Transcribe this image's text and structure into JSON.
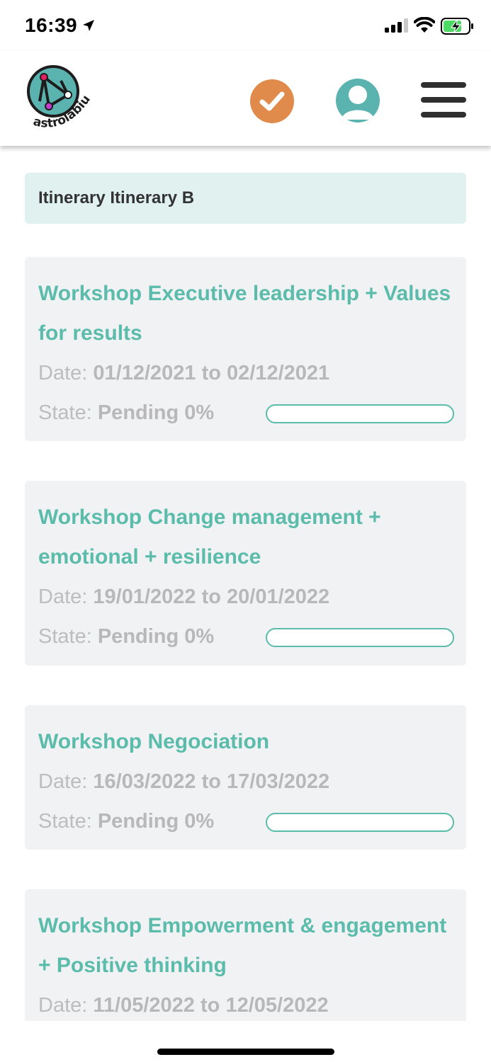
{
  "status_bar": {
    "time": "16:39"
  },
  "header": {
    "logo_text": "astrolabium",
    "icons": [
      "location-arrow-icon",
      "signal-icon",
      "wifi-icon",
      "battery-charging-icon",
      "checkmark-icon",
      "user-icon",
      "hamburger-menu-icon"
    ],
    "colors": {
      "accent": "#5bbcab",
      "check_button": "#e08b4c",
      "user_button": "#5bb3b0"
    }
  },
  "itinerary": {
    "title": "Itinerary Itinerary B"
  },
  "labels": {
    "date": "Date:",
    "to": "to",
    "state": "State:"
  },
  "workshops": [
    {
      "title": "Workshop Executive leadership + Values for results",
      "date_from": "01/12/2021",
      "date_to": "02/12/2021",
      "state": "Pending",
      "progress_text": "0%",
      "progress": 0
    },
    {
      "title": "Workshop Change management + emotional + resilience",
      "date_from": "19/01/2022",
      "date_to": "20/01/2022",
      "state": "Pending",
      "progress_text": "0%",
      "progress": 0
    },
    {
      "title": "Workshop Negociation",
      "date_from": "16/03/2022",
      "date_to": "17/03/2022",
      "state": "Pending",
      "progress_text": "0%",
      "progress": 0
    },
    {
      "title": "Workshop Empowerment & engagement + Positive thinking",
      "date_from": "11/05/2022",
      "date_to": "12/05/2022"
    }
  ]
}
